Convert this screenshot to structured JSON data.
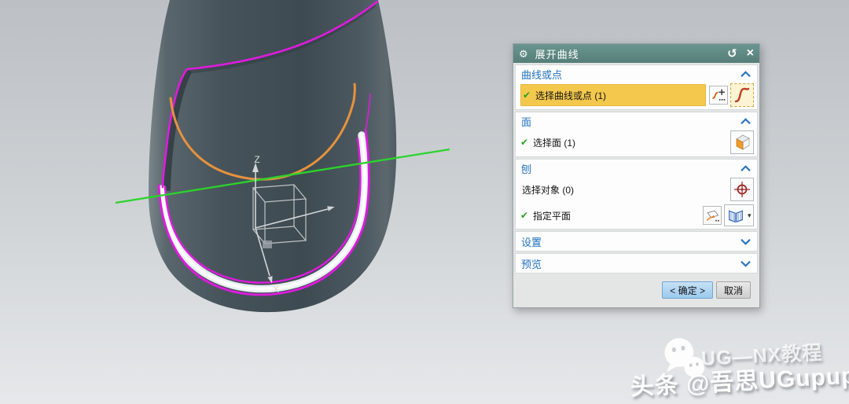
{
  "dialog": {
    "title": "展开曲线",
    "icons": {
      "gear": "⚙",
      "reset": "↺",
      "close": "×",
      "check": "✔",
      "caret": "▾"
    },
    "sections": [
      {
        "header": "曲线或点",
        "state": "expanded"
      },
      {
        "header": "面",
        "state": "expanded"
      },
      {
        "header": "刨",
        "state": "expanded"
      },
      {
        "header": "设置",
        "state": "collapsed"
      },
      {
        "header": "预览",
        "state": "collapsed"
      }
    ],
    "rows": {
      "select_curve_or_point": {
        "label": "选择曲线或点 (1)",
        "checked": true,
        "highlighted": true
      },
      "select_face": {
        "label": "选择面 (1)",
        "checked": true
      },
      "select_object": {
        "label": "选择对象 (0)",
        "checked": false
      },
      "specify_plane": {
        "label": "指定平面",
        "checked": true
      }
    },
    "buttons": {
      "ok": "< 确定 >",
      "cancel": "取消"
    },
    "colors": {
      "titlebar": "#5e8b85",
      "section_header_text": "#2272c0",
      "highlight_row": "#f3c84c",
      "ok_button": "#a9d2ef"
    }
  },
  "viewport": {
    "axis_labels": {
      "z": "Z",
      "x": "X"
    },
    "object_colors": {
      "body": "#46535a",
      "boundary_curve_magenta": "#e01ae0",
      "selected_curve_orange": "#e5923e",
      "preview_line_green": "#2bd42b",
      "cut_band": "#edf2f5"
    }
  },
  "watermark": {
    "icon": "wechat",
    "line1": "UG—NX教程",
    "line2": "头条 @吾思UGupup"
  }
}
